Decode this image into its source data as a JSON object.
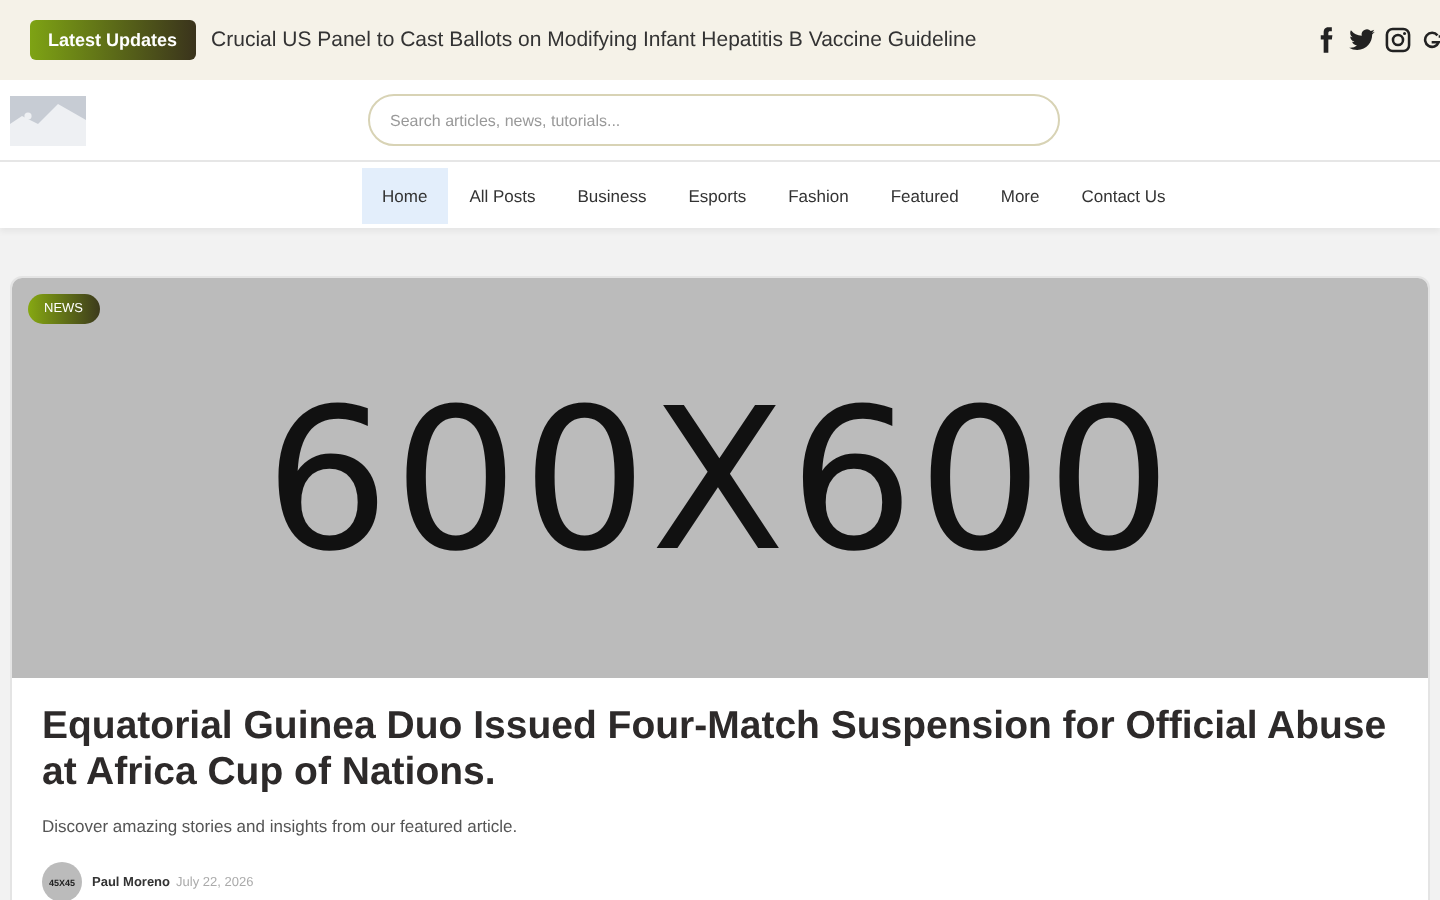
{
  "topbar": {
    "badge": "Latest Updates",
    "headline": "Crucial US Panel to Cast Ballots on Modifying Infant Hepatitis B Vaccine Guideline",
    "social": [
      {
        "kind": "facebook"
      },
      {
        "kind": "twitter"
      },
      {
        "kind": "instagram"
      },
      {
        "kind": "googleplus"
      }
    ]
  },
  "search": {
    "placeholder": "Search articles, news, tutorials..."
  },
  "nav": [
    {
      "label": "Home",
      "selected": true
    },
    {
      "label": "All Posts",
      "selected": false
    },
    {
      "label": "Business",
      "selected": false
    },
    {
      "label": "Esports",
      "selected": false
    },
    {
      "label": "Fashion",
      "selected": false
    },
    {
      "label": "Featured",
      "selected": false
    },
    {
      "label": "More",
      "selected": false
    },
    {
      "label": "Contact Us",
      "selected": false
    }
  ],
  "featured": {
    "category": "NEWS",
    "image_label": "600X600",
    "title": "Equatorial Guinea Duo Issued Four-Match Suspension for Official Abuse at Africa Cup of Nations.",
    "excerpt": "Discover amazing stories and insights from our featured article.",
    "avatar_label": "45X45",
    "author": "Paul Moreno",
    "date": "July 22, 2026"
  }
}
